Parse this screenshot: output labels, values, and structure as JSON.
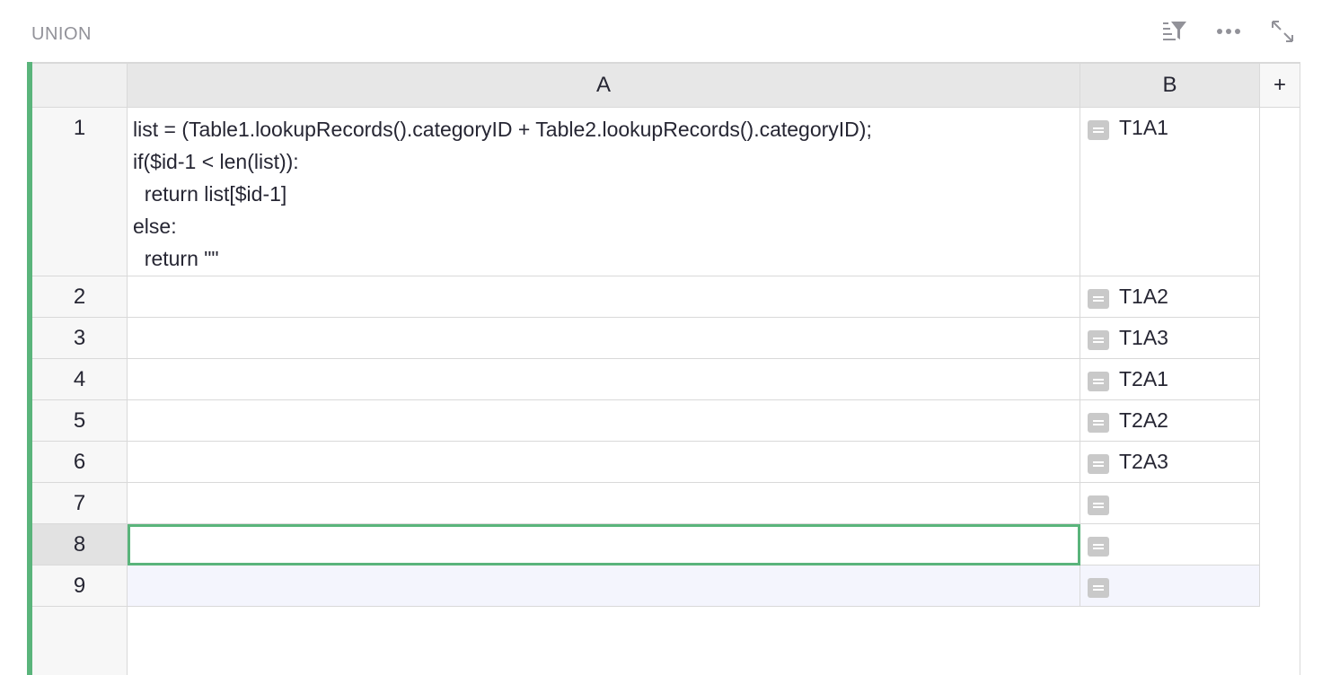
{
  "section": {
    "title": "UNION"
  },
  "toolbar": {
    "icons": [
      "sort-filter-icon",
      "more-icon",
      "expand-icon"
    ]
  },
  "columns": [
    {
      "label": "A"
    },
    {
      "label": "B"
    }
  ],
  "add_column_label": "+",
  "rows": [
    {
      "num": "1",
      "a": "list = (Table1.lookupRecords().categoryID + Table2.lookupRecords().categoryID);\nif($id-1 < len(list)):\n  return list[$id-1]\nelse:\n  return \"\"",
      "b": "T1A1"
    },
    {
      "num": "2",
      "a": "",
      "b": "T1A2"
    },
    {
      "num": "3",
      "a": "",
      "b": "T1A3"
    },
    {
      "num": "4",
      "a": "",
      "b": "T2A1"
    },
    {
      "num": "5",
      "a": "",
      "b": "T2A2"
    },
    {
      "num": "6",
      "a": "",
      "b": "T2A3"
    },
    {
      "num": "7",
      "a": "",
      "b": ""
    },
    {
      "num": "8",
      "a": "",
      "b": ""
    },
    {
      "num": "9",
      "a": "",
      "b": ""
    }
  ],
  "colors": {
    "accent_green": "#5ab47b",
    "new_row_bg": "#f4f5fd",
    "header_bg": "#e7e7e7"
  }
}
